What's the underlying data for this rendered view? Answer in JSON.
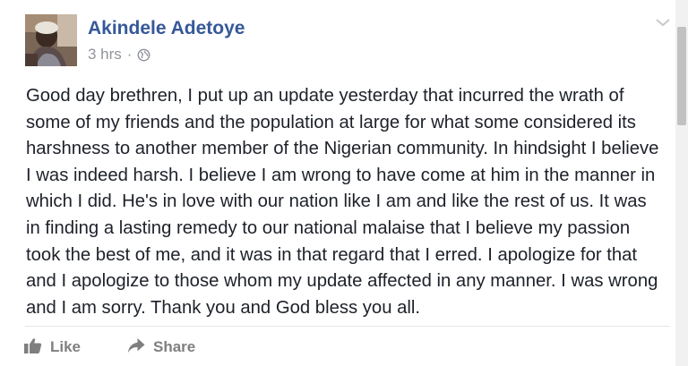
{
  "post": {
    "author": "Akindele Adetoye",
    "timestamp": "3 hrs",
    "separator": "·",
    "audience_icon": "globe-icon",
    "options_icon": "chevron-down-icon",
    "text": "Good day brethren, I put up an update yesterday that incurred the wrath of some of my friends and the population at large for what some considered its harshness to another member of the Nigerian community. In hindsight I believe I was indeed harsh. I believe I am wrong to have come at him in the manner in which I did. He's in love with our nation like I am and like the rest of us. It was in finding a lasting remedy to our national malaise that I believe my passion took the best of me, and it was in that regard that I erred. I apologize for that and I apologize to those whom my update affected in any manner. I was wrong and I am sorry. Thank you and God bless you all."
  },
  "actions": {
    "like_label": "Like",
    "like_icon": "thumbs-up-icon",
    "share_label": "Share",
    "share_icon": "share-arrow-icon"
  },
  "colors": {
    "author_link": "#365899",
    "meta_gray": "#90949c",
    "body_text": "#1d2129",
    "action_gray": "#7f7f7f"
  }
}
